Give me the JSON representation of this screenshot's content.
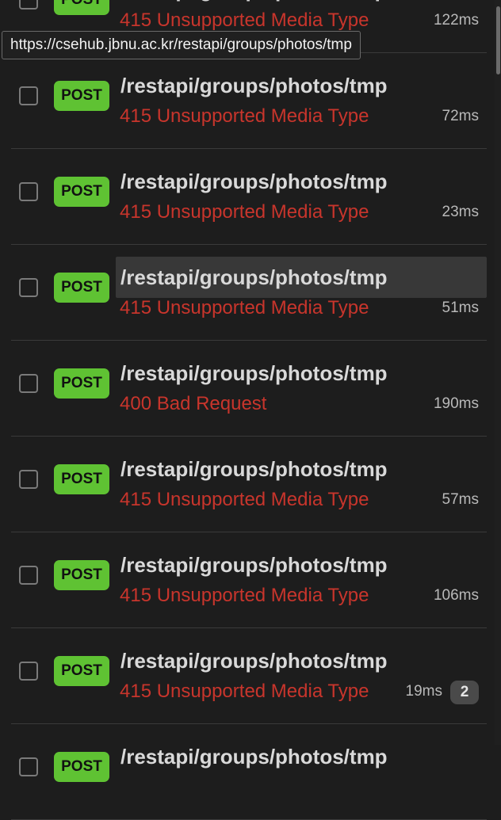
{
  "tooltip": {
    "url": "https://csehub.jbnu.ac.kr/restapi/groups/photos/tmp"
  },
  "requests": [
    {
      "method": "POST",
      "path": "/restapi/groups/photos/tmp",
      "status": "415 Unsupported Media Type",
      "time": "122ms",
      "badge": null
    },
    {
      "method": "POST",
      "path": "/restapi/groups/photos/tmp",
      "status": "415 Unsupported Media Type",
      "time": "72ms",
      "badge": null
    },
    {
      "method": "POST",
      "path": "/restapi/groups/photos/tmp",
      "status": "415 Unsupported Media Type",
      "time": "23ms",
      "badge": null
    },
    {
      "method": "POST",
      "path": "/restapi/groups/photos/tmp",
      "status": "415 Unsupported Media Type",
      "time": "51ms",
      "badge": null
    },
    {
      "method": "POST",
      "path": "/restapi/groups/photos/tmp",
      "status": "400 Bad Request",
      "time": "190ms",
      "badge": null
    },
    {
      "method": "POST",
      "path": "/restapi/groups/photos/tmp",
      "status": "415 Unsupported Media Type",
      "time": "57ms",
      "badge": null
    },
    {
      "method": "POST",
      "path": "/restapi/groups/photos/tmp",
      "status": "415 Unsupported Media Type",
      "time": "106ms",
      "badge": null
    },
    {
      "method": "POST",
      "path": "/restapi/groups/photos/tmp",
      "status": "415 Unsupported Media Type",
      "time": "19ms",
      "badge": "2"
    },
    {
      "method": "POST",
      "path": "/restapi/groups/photos/tmp",
      "status": "",
      "time": "",
      "badge": null
    }
  ],
  "colors": {
    "background": "#1d1d1d",
    "method_post": "#5fc233",
    "status_error": "#c8352c",
    "path_text": "#d9d9d9",
    "hover_highlight": "#383838"
  }
}
